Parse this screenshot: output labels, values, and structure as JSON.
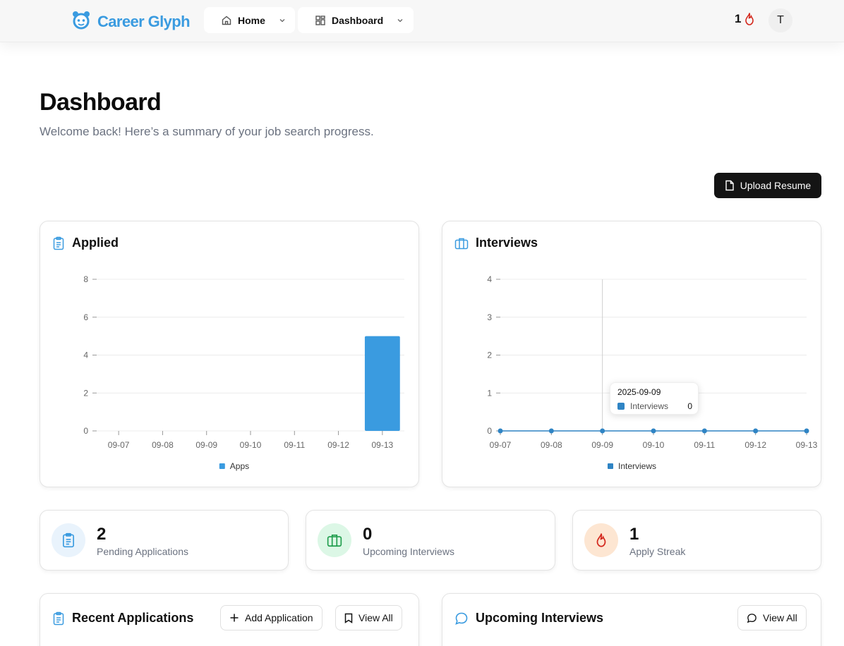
{
  "brand": {
    "name": "Career Glyph",
    "color": "#3a9be0"
  },
  "nav": {
    "home": {
      "label": "Home",
      "icon": "home-icon"
    },
    "dashboard": {
      "label": "Dashboard",
      "icon": "grid-icon"
    }
  },
  "streak": {
    "count": "1",
    "icon": "flame-icon"
  },
  "user": {
    "initial": "T"
  },
  "page": {
    "title": "Dashboard",
    "subtitle": "Welcome back! Here’s a summary of your job search progress."
  },
  "actions": {
    "upload_resume": "Upload Resume"
  },
  "applied_card": {
    "title": "Applied"
  },
  "interviews_card": {
    "title": "Interviews"
  },
  "chart_data": [
    {
      "type": "bar",
      "categories": [
        "09-07",
        "09-08",
        "09-09",
        "09-10",
        "09-11",
        "09-12",
        "09-13"
      ],
      "series": [
        {
          "name": "Apps",
          "values": [
            0,
            0,
            0,
            0,
            0,
            0,
            5
          ],
          "color": "#3a9be0"
        }
      ],
      "y_ticks": [
        "0",
        "2",
        "4",
        "6",
        "8"
      ],
      "ylim": [
        0,
        8
      ],
      "grid": true,
      "legend": "bottom"
    },
    {
      "type": "line",
      "categories": [
        "09-07",
        "09-08",
        "09-09",
        "09-10",
        "09-11",
        "09-12",
        "09-13"
      ],
      "series": [
        {
          "name": "Interviews",
          "values": [
            0,
            0,
            0,
            0,
            0,
            0,
            0
          ],
          "color": "#2f84c4"
        }
      ],
      "y_ticks": [
        "0",
        "1",
        "2",
        "3",
        "4"
      ],
      "ylim": [
        0,
        4
      ],
      "grid": true,
      "legend": "bottom",
      "tooltip": {
        "date": "2025-09-09",
        "series": "Interviews",
        "value": "0",
        "index": 2
      }
    }
  ],
  "stats": [
    {
      "value": "2",
      "label": "Pending Applications",
      "icon": "clipboard-icon",
      "bg": "#e9f3fc",
      "color": "#3a9be0"
    },
    {
      "value": "0",
      "label": "Upcoming Interviews",
      "icon": "briefcase-icon",
      "bg": "#dcf7e6",
      "color": "#1f9d4c"
    },
    {
      "value": "1",
      "label": "Apply Streak",
      "icon": "flame-icon",
      "bg": "#fde6d2",
      "color": "#d42a1f"
    }
  ],
  "recent_applications": {
    "title": "Recent Applications",
    "add_label": "Add Application",
    "view_all_label": "View All"
  },
  "upcoming_interviews": {
    "title": "Upcoming Interviews",
    "view_all_label": "View All"
  }
}
